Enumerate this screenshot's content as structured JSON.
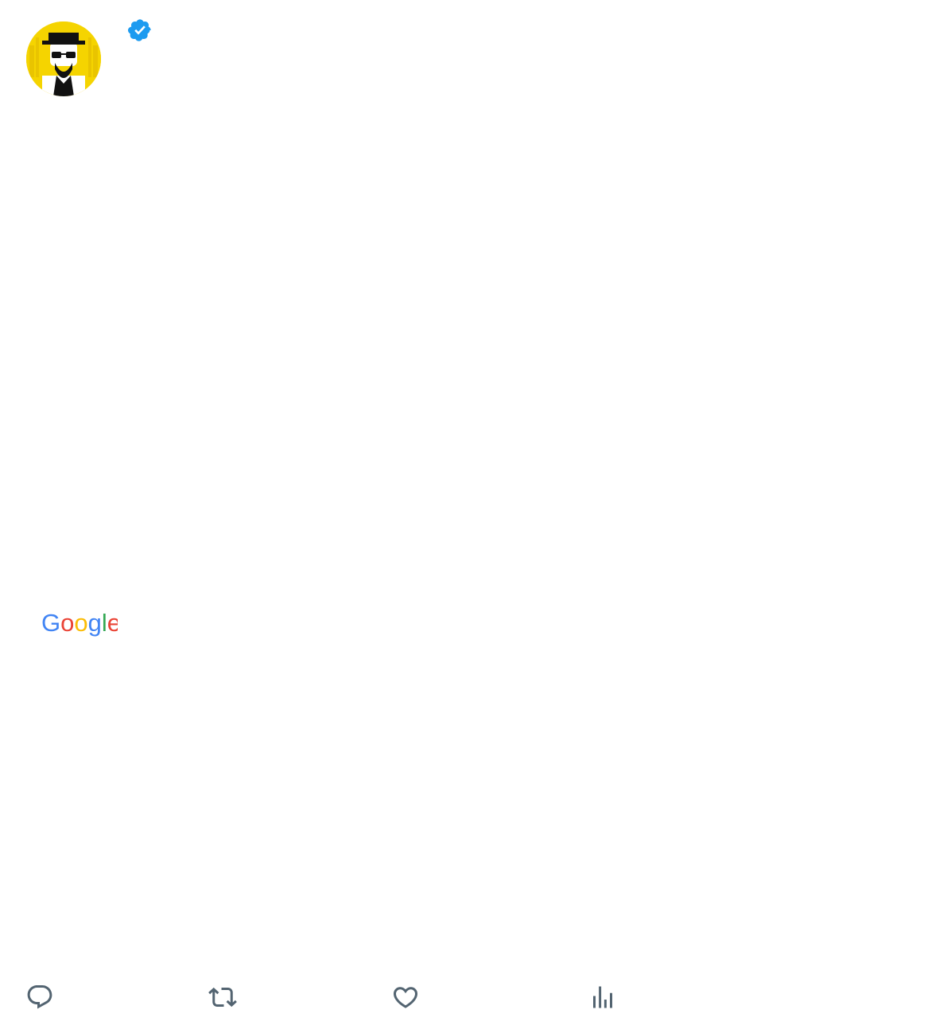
{
  "colors": {
    "text": "#0f1419",
    "secondary": "#536471",
    "verified": "#1d9bf0",
    "avatar_bg": "#f5d400"
  },
  "author": {
    "display_name": "",
    "handle": "",
    "avatar_icon": "heisenberg-avatar-icon",
    "verified_icon": "verified-badge-icon"
  },
  "tweet": {
    "paragraphs": [
      "",
      "",
      "",
      "",
      "",
      ""
    ],
    "translation": {
      "prefix": "",
      "brand": "",
      "suffix": "",
      "language": "",
      "text": ""
    }
  },
  "meta": {
    "time": "",
    "sep1": "",
    "date": "",
    "sep2": "",
    "views": "",
    "views_label": ""
  },
  "actions": [
    {
      "icon": "reply-icon",
      "count": ""
    },
    {
      "icon": "retweet-icon",
      "count": ""
    },
    {
      "icon": "like-icon",
      "count": ""
    },
    {
      "icon": "views-icon",
      "count": ""
    }
  ]
}
